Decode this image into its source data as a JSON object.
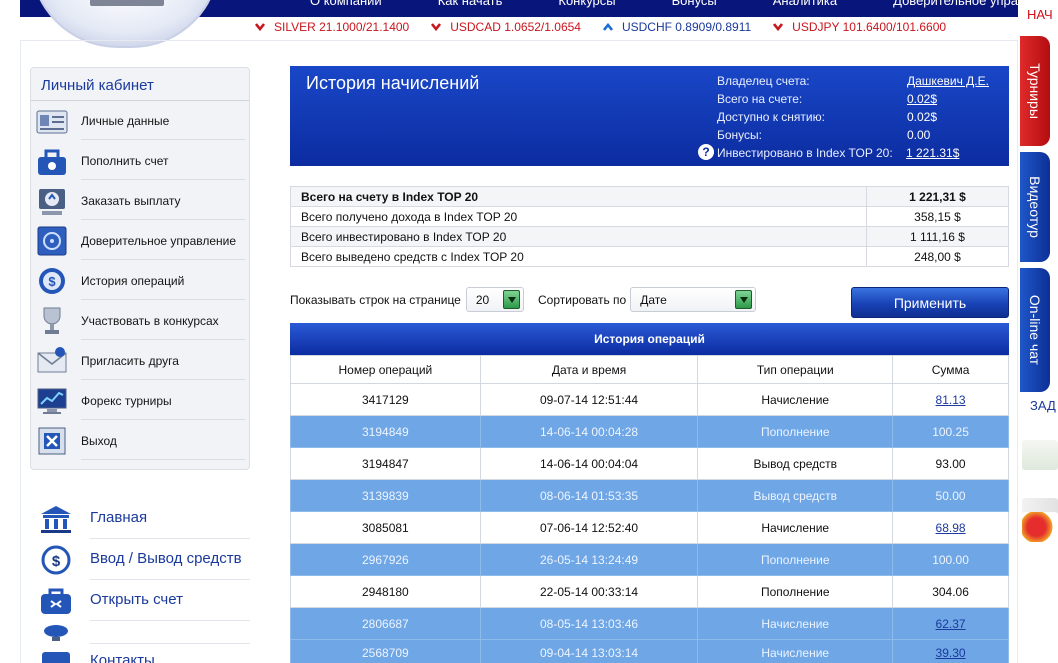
{
  "top_menu": [
    "О компании",
    "Как начать",
    "Конкурсы",
    "Бонусы",
    "Аналитика",
    "Доверительное управление"
  ],
  "ticker": [
    {
      "symbol": "SILVER",
      "price": "21.1000/21.1400",
      "dir": "down"
    },
    {
      "symbol": "USDCAD",
      "price": "1.0652/1.0654",
      "dir": "down"
    },
    {
      "symbol": "USDCHF",
      "price": "0.8909/0.8911",
      "dir": "up"
    },
    {
      "symbol": "USDJPY",
      "price": "101.6400/101.6600",
      "dir": "down"
    }
  ],
  "ticker_text": [
    "SILVER 21.1000/21.1400",
    "USDCAD 1.0652/1.0654",
    "USDCHF 0.8909/0.8911",
    "USDJPY 101.6400/101.6600"
  ],
  "cabinet": {
    "title": "Личный кабинет",
    "items": [
      {
        "label": "Личные данные",
        "icon": "id-card-icon"
      },
      {
        "label": "Пополнить счет",
        "icon": "deposit-bag-icon"
      },
      {
        "label": "Заказать выплату",
        "icon": "payout-icon"
      },
      {
        "label": "Доверительное управление",
        "icon": "safe-icon"
      },
      {
        "label": "История операций",
        "icon": "history-icon"
      },
      {
        "label": "Участвовать в конкурсах",
        "icon": "trophy-icon"
      },
      {
        "label": "Пригласить друга",
        "icon": "envelope-icon"
      },
      {
        "label": "Форекс турниры",
        "icon": "monitor-chart-icon"
      },
      {
        "label": "Выход",
        "icon": "exit-icon"
      }
    ]
  },
  "bottom_nav": [
    {
      "label": "Главная",
      "icon": "bank-icon"
    },
    {
      "label": "Ввод / Вывод средств",
      "icon": "dollar-arrows-icon"
    },
    {
      "label": "Открыть счет",
      "icon": "open-account-icon"
    },
    {
      "label": "",
      "icon": "globe-icon"
    },
    {
      "label": "Контакты",
      "icon": "contacts-icon"
    }
  ],
  "history": {
    "title": "История начислений",
    "owner_label": "Владелец счета:",
    "owner_value": "Дашкевич Д.Е.",
    "total_label": "Всего на счете:",
    "total_value": "0.02$",
    "avail_label": "Доступно к снятию:",
    "avail_value": "0.02$",
    "bonus_label": "Бонусы:",
    "bonus_value": "0.00",
    "invested_label": "Инвестировано в Index TOP 20:",
    "invested_value": "1 221.31$",
    "help_glyph": "?"
  },
  "summary": [
    {
      "label": "Всего на счету в Index TOP 20",
      "value": "1 221,31 $"
    },
    {
      "label": "Всего получено дохода в Index TOP 20",
      "value": "358,15 $"
    },
    {
      "label": "Всего инвестировано в Index TOP 20",
      "value": "1 111,16 $"
    },
    {
      "label": "Всего выведено средств с Index TOP 20",
      "value": "248,00 $"
    }
  ],
  "controls": {
    "rows_label": "Показывать строк на странице",
    "rows_value": "20",
    "sort_label": "Сортировать по",
    "sort_value": "Дате",
    "apply": "Применить"
  },
  "operations": {
    "title": "История операций",
    "columns": [
      "Номер операций",
      "Дата и время",
      "Тип операции",
      "Сумма"
    ],
    "rows": [
      {
        "id": "3417129",
        "date": "09-07-14 12:51:44",
        "type": "Начисление",
        "amount": "81.13",
        "link": true
      },
      {
        "id": "3194849",
        "date": "14-06-14 00:04:28",
        "type": "Пополнение",
        "amount": "100.25",
        "link": false
      },
      {
        "id": "3194847",
        "date": "14-06-14 00:04:04",
        "type": "Вывод средств",
        "amount": "93.00",
        "link": false
      },
      {
        "id": "3139839",
        "date": "08-06-14 01:53:35",
        "type": "Вывод средств",
        "amount": "50.00",
        "link": false
      },
      {
        "id": "3085081",
        "date": "07-06-14 12:52:40",
        "type": "Начисление",
        "amount": "68.98",
        "link": true
      },
      {
        "id": "2967926",
        "date": "26-05-14 13:24:49",
        "type": "Пополнение",
        "amount": "100.00",
        "link": false
      },
      {
        "id": "2948180",
        "date": "22-05-14 00:33:14",
        "type": "Пополнение",
        "amount": "304.06",
        "link": false
      },
      {
        "id": "2806687",
        "date": "08-05-14 13:03:46",
        "type": "Начисление",
        "amount": "62.37",
        "link": true
      },
      {
        "id": "2568709",
        "date": "09-04-14 13:03:14",
        "type": "Начисление",
        "amount": "39.30",
        "link": true
      }
    ]
  },
  "right_side": {
    "top_text": "НАЧ",
    "tabs": [
      "Турниры",
      "Видеотур",
      "On-line чат"
    ],
    "bottom_text": "ЗАД"
  },
  "colors": {
    "nav": "#08157a",
    "accent": "#0c2ca0",
    "row_blue": "#6ea6e6",
    "down": "#c8161d"
  }
}
